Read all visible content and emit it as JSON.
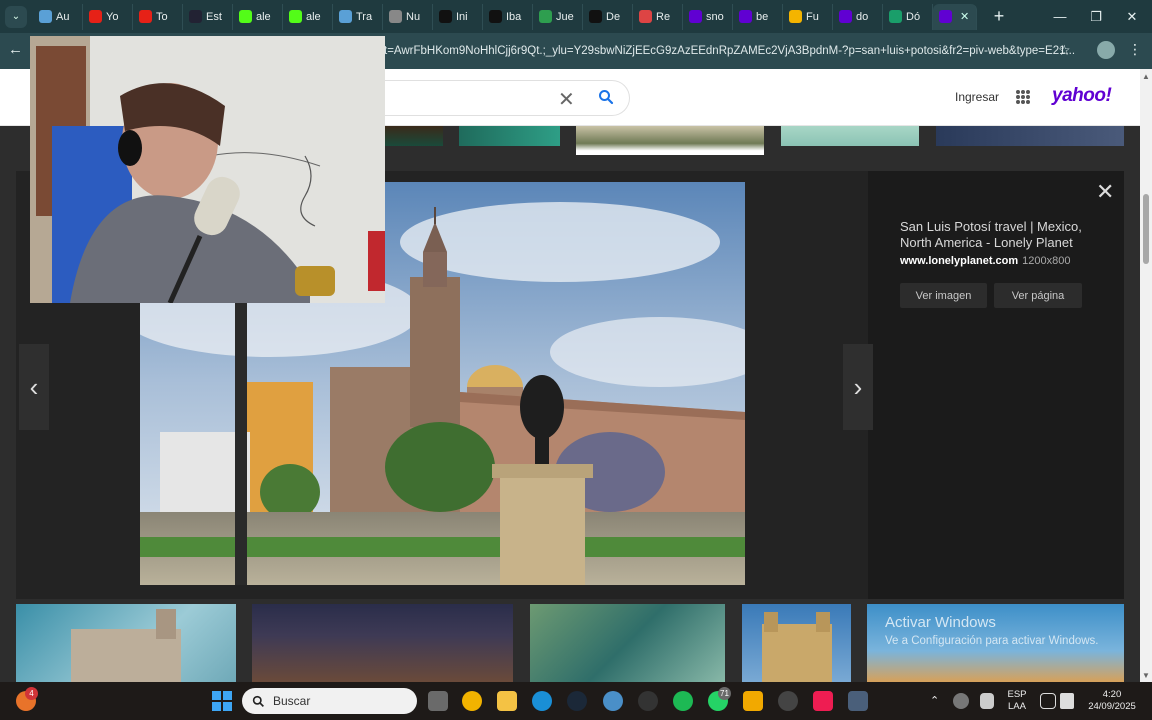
{
  "browser": {
    "tabs": [
      {
        "label": "Au",
        "icon": "document-icon",
        "color": "#5aa0d6"
      },
      {
        "label": "Yo",
        "icon": "youtube-icon",
        "color": "#e62117"
      },
      {
        "label": "To",
        "icon": "youtube-icon",
        "color": "#e62117"
      },
      {
        "label": "Est",
        "icon": "dark-circle-icon",
        "color": "#223"
      },
      {
        "label": "ale",
        "icon": "kick-icon",
        "color": "#53fc18"
      },
      {
        "label": "ale",
        "icon": "kick-icon",
        "color": "#53fc18"
      },
      {
        "label": "Tra",
        "icon": "translate-icon",
        "color": "#5aa0d6"
      },
      {
        "label": "Nu",
        "icon": "globe-icon",
        "color": "#888"
      },
      {
        "label": "Ini",
        "icon": "x-icon",
        "color": "#111"
      },
      {
        "label": "Iba",
        "icon": "x-icon",
        "color": "#111"
      },
      {
        "label": "Jue",
        "icon": "person-icon",
        "color": "#2e9e4f"
      },
      {
        "label": "De",
        "icon": "tiktok-icon",
        "color": "#111"
      },
      {
        "label": "Re",
        "icon": "gmail-icon",
        "color": "#d44"
      },
      {
        "label": "sno",
        "icon": "yahoo-icon",
        "color": "#6001d2"
      },
      {
        "label": "be",
        "icon": "yahoo-icon",
        "color": "#6001d2"
      },
      {
        "label": "Fu",
        "icon": "drive-icon",
        "color": "#f4b400"
      },
      {
        "label": "do",
        "icon": "yahoo-icon",
        "color": "#6001d2"
      },
      {
        "label": "Dó",
        "icon": "currency-icon",
        "color": "#1a9e6a"
      },
      {
        "label": "",
        "icon": "yahoo-icon",
        "color": "#6001d2",
        "active": true
      }
    ],
    "new_tab": "+",
    "address": "t=AwrFbHKom9NoHhlCjj6r9Qt.;_ylu=Y29sbwNiZjEEcG9zAzEEdnRpZAMEc2VjA3BpdnM-?p=san+luis+potosi&fr2=piv-web&type=E21..."
  },
  "yahoo": {
    "login": "Ingresar",
    "logo": "yahoo!"
  },
  "viewer": {
    "title": "San Luis Potosí travel | Mexico, North America - Lonely Planet",
    "source": "www.lonelyplanet.com",
    "size": "1200x800",
    "view_image": "Ver imagen",
    "view_page": "Ver página"
  },
  "watermark": {
    "title": "Activar Windows",
    "subtitle": "Ve a Configuración para activar Windows."
  },
  "taskbar": {
    "search_placeholder": "Buscar",
    "lang_top": "ESP",
    "lang_bottom": "LAA",
    "time": "4:20",
    "date": "24/09/2025",
    "whatsapp_badge": "71",
    "start_badge": "4"
  }
}
